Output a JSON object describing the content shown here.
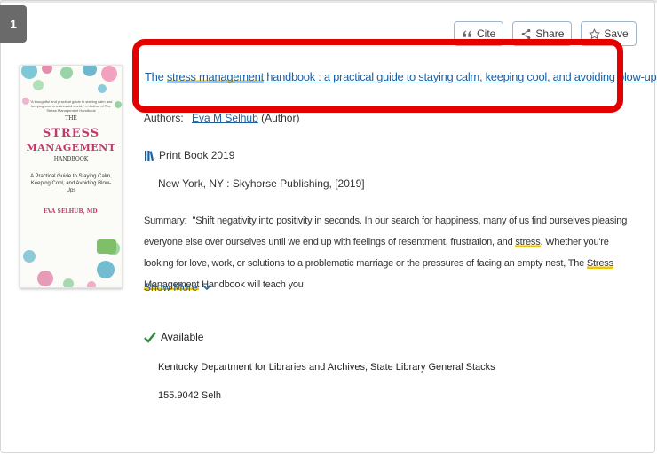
{
  "result": {
    "number": "1",
    "actions": {
      "cite": "Cite",
      "share": "Share",
      "save": "Save"
    },
    "cover": {
      "quote": "\"A thoughtful and practical guide to staying calm and keeping cool in a stressful world.\" — Author of The Stress Management Handbook",
      "title_line1": "THE",
      "title_line2": "STRESS",
      "title_line3": "MANAGEMENT",
      "title_line4": "HANDBOOK",
      "subtitle": "A Practical Guide to Staying Calm, Keeping Cool, and Avoiding Blow-Ups",
      "author": "EVA SELHUB, MD"
    },
    "title_parts": {
      "p1": "The ",
      "p2": "stress management",
      "p3": " handbook : a practical guide to staying calm, keeping cool, and avoiding blow-ups"
    },
    "authors_label": "Authors:",
    "author_name": "Eva M Selhub",
    "author_role": "(Author)",
    "format": "Print Book 2019",
    "publisher": "New York, NY : Skyhorse Publishing, [2019]",
    "summary_label": "Summary:",
    "summary_parts": {
      "s1": "\"Shift negativity into positivity in seconds. In our search for happiness, many of us find ourselves pleasing everyone else over ourselves until we end up with feelings of resentment, frustration, and ",
      "s2": "stress",
      "s3": ". Whether you're looking for love, work, or solutions to a problematic marriage or the pressures of facing an empty nest, The ",
      "s4": "Stress Management",
      "s5": " Handbook will teach you"
    },
    "show_more": "Show More",
    "availability": "Available",
    "location": "Kentucky Department for Libraries and Archives, State Library General Stacks",
    "call_number": "155.9042 Selh"
  },
  "colors": {
    "link": "#1f5f9e",
    "highlight_box": "#e50000",
    "search_highlight": "#f1c400",
    "available_check": "#2e8b3d",
    "cover_title": "#c0396b"
  }
}
